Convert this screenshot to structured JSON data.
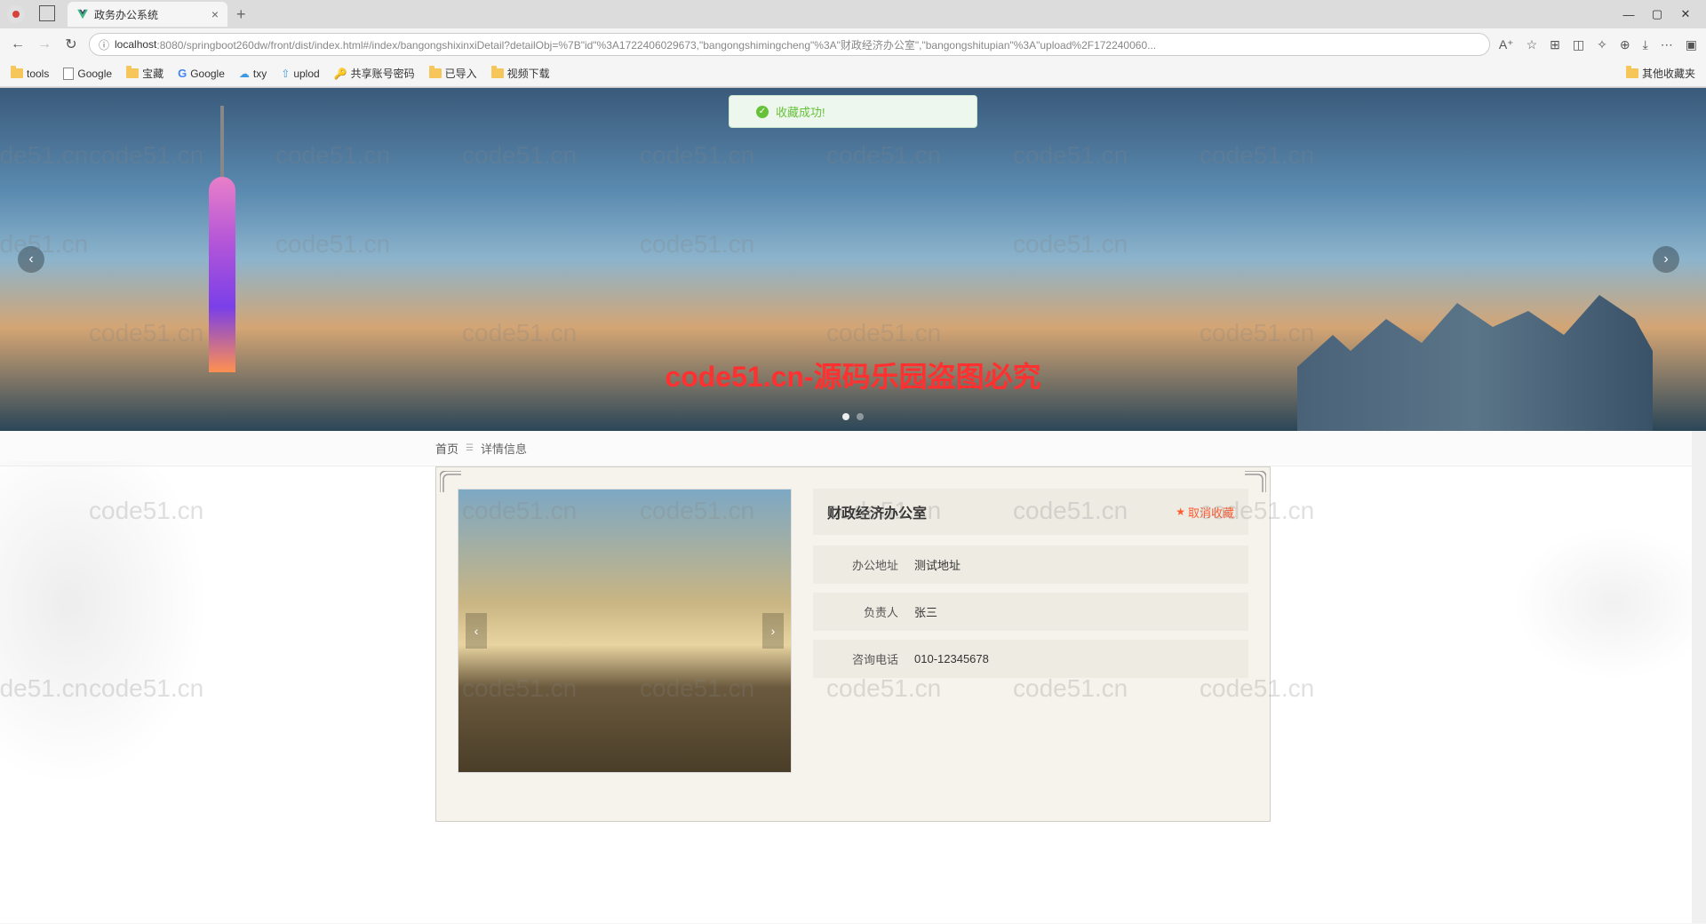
{
  "browser": {
    "tab_title": "政务办公系统",
    "url_host": "localhost",
    "url_path": ":8080/springboot260dw/front/dist/index.html#/index/bangongshixinxiDetail?detailObj=%7B\"id\"%3A1722406029673,\"bangongshimingcheng\"%3A\"财政经济办公室\",\"bangongshitupian\"%3A\"upload%2F172240060...",
    "bookmarks": [
      {
        "type": "folder",
        "label": "tools"
      },
      {
        "type": "page",
        "label": "Google"
      },
      {
        "type": "folder",
        "label": "宝藏"
      },
      {
        "type": "google",
        "label": "Google"
      },
      {
        "type": "icon",
        "label": "txy"
      },
      {
        "type": "icon",
        "label": "uplod"
      },
      {
        "type": "icon",
        "label": "共享账号密码"
      },
      {
        "type": "folder",
        "label": "已导入"
      },
      {
        "type": "folder",
        "label": "视频下载"
      }
    ],
    "bookmark_right": "其他收藏夹"
  },
  "toast": {
    "message": "收藏成功!"
  },
  "banner": {
    "watermark": "code51.cn-源码乐园盗图必究"
  },
  "breadcrumb": {
    "home": "首页",
    "current": "详情信息"
  },
  "detail": {
    "title": "财政经济办公室",
    "favorite_label": "取消收藏",
    "rows": [
      {
        "label": "办公地址",
        "value": "测试地址"
      },
      {
        "label": "负责人",
        "value": "张三"
      },
      {
        "label": "咨询电话",
        "value": "010-12345678"
      }
    ]
  },
  "watermark_text": "code51.cn"
}
